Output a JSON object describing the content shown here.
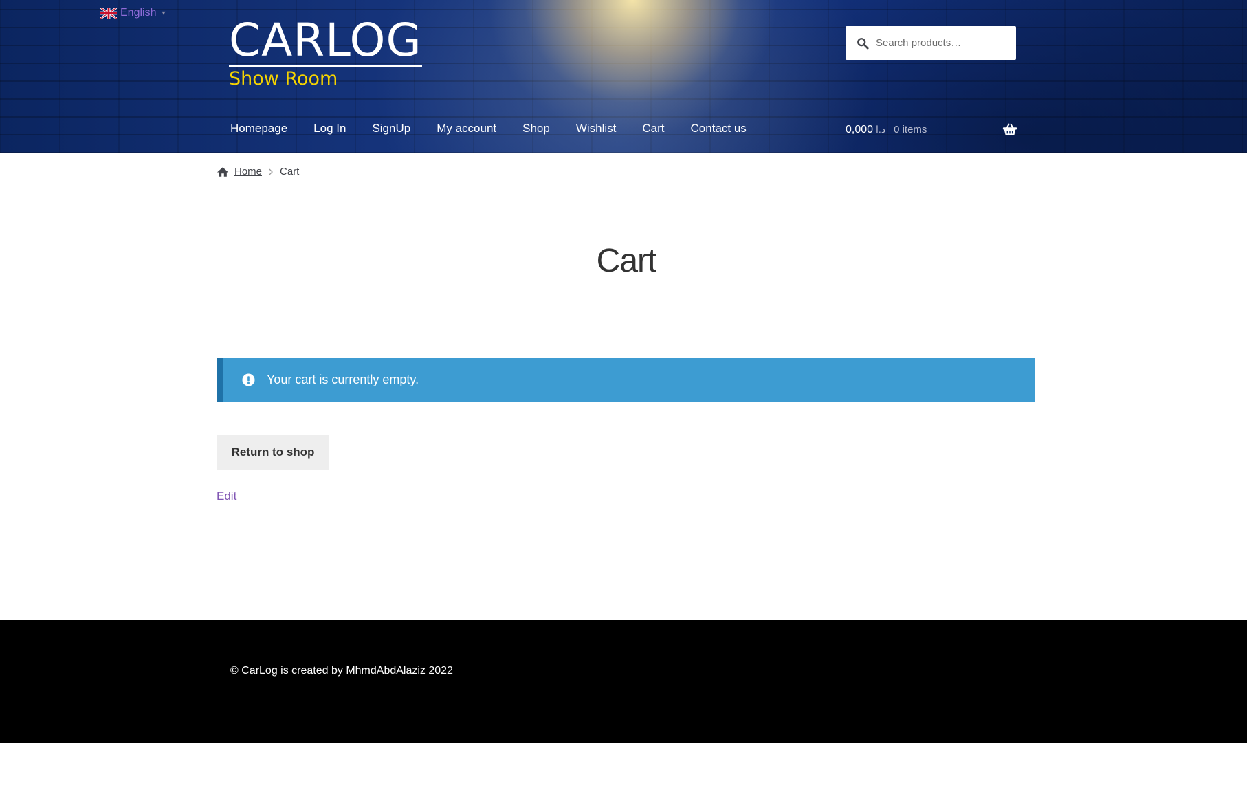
{
  "language": {
    "label": "English",
    "caret": "▾",
    "flag": "uk-flag-icon"
  },
  "site": {
    "title": "CARLOG",
    "subtitle": "Show Room"
  },
  "search": {
    "placeholder": "Search products…"
  },
  "nav": {
    "items": [
      {
        "label": "Homepage"
      },
      {
        "label": "Log In"
      },
      {
        "label": "SignUp"
      },
      {
        "label": "My account"
      },
      {
        "label": "Shop"
      },
      {
        "label": "Wishlist"
      },
      {
        "label": "Cart"
      },
      {
        "label": "Contact us"
      }
    ]
  },
  "cart_summary": {
    "amount": "0,000",
    "currency": "د.ا",
    "count": "0 items",
    "icon": "basket-icon"
  },
  "breadcrumb": {
    "home": "Home",
    "separator_icon": "chevron-right-icon",
    "current": "Cart"
  },
  "page": {
    "title": "Cart"
  },
  "notice": {
    "text": "Your cart is currently empty.",
    "icon": "info-icon"
  },
  "actions": {
    "return_label": "Return to shop",
    "edit_label": "Edit"
  },
  "footer": {
    "text": "© CarLog is created by MhmdAbdAlaziz 2022"
  },
  "colors": {
    "header_bg": "#0d2a63",
    "notice_bg": "#3d9cd2",
    "notice_border": "#1f72a8",
    "logo_subtitle": "#f5d300",
    "link_purple": "#7f54b3",
    "footer_bg": "#000000",
    "button_bg": "#eeeeee"
  }
}
